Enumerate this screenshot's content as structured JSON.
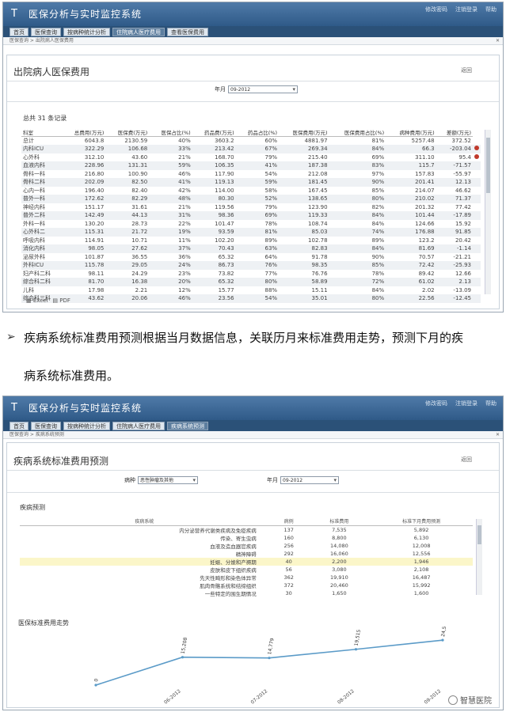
{
  "app": {
    "logo": "T",
    "title": "医保分析与实时监控系统",
    "header_links": [
      "修改密码",
      "注销登录",
      "帮助"
    ]
  },
  "screen1": {
    "tabs": [
      "首页",
      "医保查询",
      "按病种统计分析",
      "住院病人医疗费用",
      "查看医保费用"
    ],
    "active_tab": 3,
    "breadcrumb": "医保查询 > 出院病人医保费用",
    "page_title": "出院病人医保费用",
    "back_label": "返回",
    "filter_label": "年月",
    "filter_value": "09-2012",
    "subheader": "总共 31 条记录",
    "columns": [
      "科室",
      "总费用(万元)",
      "医保费(万元)",
      "医保占比(%)",
      "药品费(万元)",
      "药品占比(%)",
      "医保费用(万元)",
      "医保费用占比(%)",
      "病种费用(万元)",
      "差额(万元)"
    ],
    "rows": [
      [
        "总计",
        "6043.8",
        "2130.59",
        "40%",
        "3603.2",
        "60%",
        "4881.97",
        "81%",
        "5257.48",
        "372.52"
      ],
      [
        "内科ICU",
        "322.29",
        "106.68",
        "33%",
        "213.42",
        "67%",
        "269.34",
        "84%",
        "66.3",
        "-203.04"
      ],
      [
        "心外科",
        "312.10",
        "43.60",
        "21%",
        "168.70",
        "79%",
        "215.40",
        "69%",
        "311.10",
        "95.4"
      ],
      [
        "血液内科",
        "228.96",
        "131.31",
        "59%",
        "106.35",
        "41%",
        "187.38",
        "83%",
        "115.7",
        "-71.57"
      ],
      [
        "骨科一科",
        "216.80",
        "100.90",
        "46%",
        "117.90",
        "54%",
        "212.08",
        "97%",
        "157.83",
        "-55.97"
      ],
      [
        "骨科二科",
        "202.09",
        "82.50",
        "41%",
        "119.13",
        "59%",
        "181.45",
        "90%",
        "201.41",
        "12.13"
      ],
      [
        "心内一科",
        "196.40",
        "82.40",
        "42%",
        "114.00",
        "58%",
        "167.45",
        "85%",
        "214.07",
        "46.62"
      ],
      [
        "普外一科",
        "172.62",
        "82.29",
        "48%",
        "80.30",
        "52%",
        "138.65",
        "80%",
        "210.02",
        "71.37"
      ],
      [
        "神经内科",
        "151.17",
        "31.61",
        "21%",
        "119.56",
        "79%",
        "123.90",
        "82%",
        "201.32",
        "77.42"
      ],
      [
        "普外二科",
        "142.49",
        "44.13",
        "31%",
        "98.36",
        "69%",
        "119.33",
        "84%",
        "101.44",
        "-17.89"
      ],
      [
        "外科一科",
        "130.20",
        "28.73",
        "22%",
        "101.47",
        "78%",
        "108.74",
        "84%",
        "124.66",
        "15.92"
      ],
      [
        "心外科二",
        "115.31",
        "21.72",
        "19%",
        "93.59",
        "81%",
        "85.03",
        "74%",
        "176.88",
        "91.85"
      ],
      [
        "呼吸内科",
        "114.91",
        "10.71",
        "11%",
        "102.20",
        "89%",
        "102.78",
        "89%",
        "123.2",
        "20.42"
      ],
      [
        "消化内科",
        "98.05",
        "27.62",
        "37%",
        "70.43",
        "63%",
        "82.83",
        "84%",
        "81.69",
        "-1.14"
      ],
      [
        "泌尿外科",
        "101.87",
        "36.55",
        "36%",
        "65.32",
        "64%",
        "91.78",
        "90%",
        "70.57",
        "-21.21"
      ],
      [
        "外科ICU",
        "115.78",
        "29.05",
        "24%",
        "86.73",
        "76%",
        "98.35",
        "85%",
        "72.42",
        "-25.93"
      ],
      [
        "妇产科二科",
        "98.11",
        "24.29",
        "23%",
        "73.82",
        "77%",
        "76.76",
        "78%",
        "89.42",
        "12.66"
      ],
      [
        "综合科二科",
        "81.70",
        "16.38",
        "20%",
        "65.32",
        "80%",
        "58.89",
        "72%",
        "61.02",
        "2.13"
      ],
      [
        "儿科",
        "17.98",
        "2.21",
        "12%",
        "15.77",
        "88%",
        "15.11",
        "84%",
        "2.02",
        "-13.09"
      ],
      [
        "综合科三科",
        "43.62",
        "20.06",
        "46%",
        "23.56",
        "54%",
        "35.01",
        "80%",
        "22.56",
        "-12.45"
      ]
    ],
    "alert_rows": [
      1,
      2
    ],
    "export_labels": [
      "Excel",
      "PDF"
    ]
  },
  "description": {
    "bullet": "➢",
    "line1": "疾病系统标准费用预测根据当月数据信息，关联历月来标准费用走势，预测下月的疾",
    "line2": "病系统标准费用。"
  },
  "screen2": {
    "tabs": [
      "首页",
      "医保查询",
      "按病种统计分析",
      "住院病人医疗费用",
      "疾病系统预测"
    ],
    "active_tab": 4,
    "breadcrumb": "医保查询 > 疾病系统预测",
    "page_title": "疾病系统标准费用预测",
    "back_label": "返回",
    "filter1_label": "病种",
    "filter1_value": "恶性肿瘤及其他",
    "filter2_label": "年月",
    "filter2_value": "09-2012",
    "section1_title": "疾病预测",
    "columns": [
      "疾病系统",
      "病例",
      "标准费用",
      "标准下月费用预测"
    ],
    "rows": [
      [
        "内分泌营养代谢类疾病及免疫疾病",
        "137",
        "7,535",
        "5,892"
      ],
      [
        "传染、寄生虫病",
        "160",
        "8,800",
        "6,130"
      ],
      [
        "血液及造血器官疾病",
        "256",
        "14,080",
        "12,008"
      ],
      [
        "精神障碍",
        "292",
        "16,060",
        "12,556"
      ],
      [
        "妊娠、分娩和产褥期",
        "40",
        "2,200",
        "1,946"
      ],
      [
        "皮肤和皮下组织疾病",
        "56",
        "3,080",
        "2,108"
      ],
      [
        "先天性畸形和染色体异常",
        "362",
        "19,910",
        "16,487"
      ],
      [
        "肌肉骨骼系统和结缔组织",
        "372",
        "20,460",
        "15,992"
      ],
      [
        "一些特定的围生期情况",
        "30",
        "1,650",
        "1,600"
      ]
    ],
    "highlight_row": 4,
    "section2_title": "医保标准费用走势",
    "chart_data": {
      "type": "line",
      "categories": [
        "",
        "06-2012",
        "07-2012",
        "08-2012",
        "09-2012"
      ],
      "series": [
        {
          "values": [
            0,
            15.2,
            14.8,
            19.5,
            24.5
          ]
        }
      ],
      "data_labels": [
        "0",
        "15,208",
        "14,779",
        "19,515",
        "24,544"
      ],
      "line_color": "#5b9bc8"
    }
  },
  "watermark": "智慧医院"
}
